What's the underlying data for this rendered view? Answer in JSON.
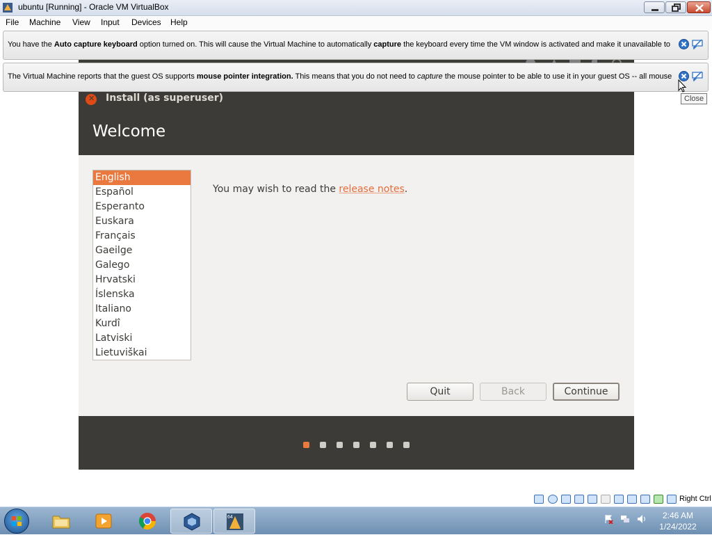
{
  "window": {
    "title": "ubuntu [Running] - Oracle VM VirtualBox"
  },
  "menubar": {
    "items": [
      "File",
      "Machine",
      "View",
      "Input",
      "Devices",
      "Help"
    ]
  },
  "notifications": [
    {
      "parts": [
        "You have the ",
        "Auto capture keyboard",
        " option turned on. This will cause the Virtual Machine to automatically ",
        "capture",
        " the keyboard every time the VM window is activated and make it unavailable to"
      ]
    },
    {
      "parts": [
        "The Virtual Machine reports that the guest OS supports ",
        "mouse pointer integration.",
        " This means that you do not need to ",
        "capture",
        " the mouse pointer to be able to use it in your guest OS -- all mouse"
      ]
    }
  ],
  "tooltip": "Close",
  "installer": {
    "window_title": "Install (as superuser)",
    "heading": "Welcome",
    "languages": [
      "English",
      "Español",
      "Esperanto",
      "Euskara",
      "Français",
      "Gaeilge",
      "Galego",
      "Hrvatski",
      "Íslenska",
      "Italiano",
      "Kurdî",
      "Latviski",
      "Lietuviškai"
    ],
    "selected_language": "English",
    "notes_prefix": "You may wish to read the ",
    "notes_link": "release notes",
    "notes_suffix": ".",
    "buttons": {
      "quit": "Quit",
      "back": "Back",
      "continue": "Continue"
    },
    "progress": {
      "current_step": 1,
      "total_steps": 7
    },
    "accent_color": "#e9793f",
    "header_color": "#3c3b37"
  },
  "statusbar": {
    "host_key": "Right Ctrl",
    "icons": [
      "hard-disk-icon",
      "optical-drive-icon",
      "audio-icon",
      "network-icon",
      "usb-icon",
      "shared-folders-icon",
      "display-icon",
      "video-capture-icon",
      "virtualization-icon",
      "mouse-integration-icon",
      "keyboard-capture-icon"
    ]
  },
  "taskbar": {
    "apps": [
      "start-icon",
      "file-explorer-icon",
      "media-player-icon",
      "chrome-icon",
      "virtualbox-icon",
      "virtualbox-64-icon"
    ],
    "clock_time": "2:46 AM",
    "clock_date": "1/24/2022"
  }
}
